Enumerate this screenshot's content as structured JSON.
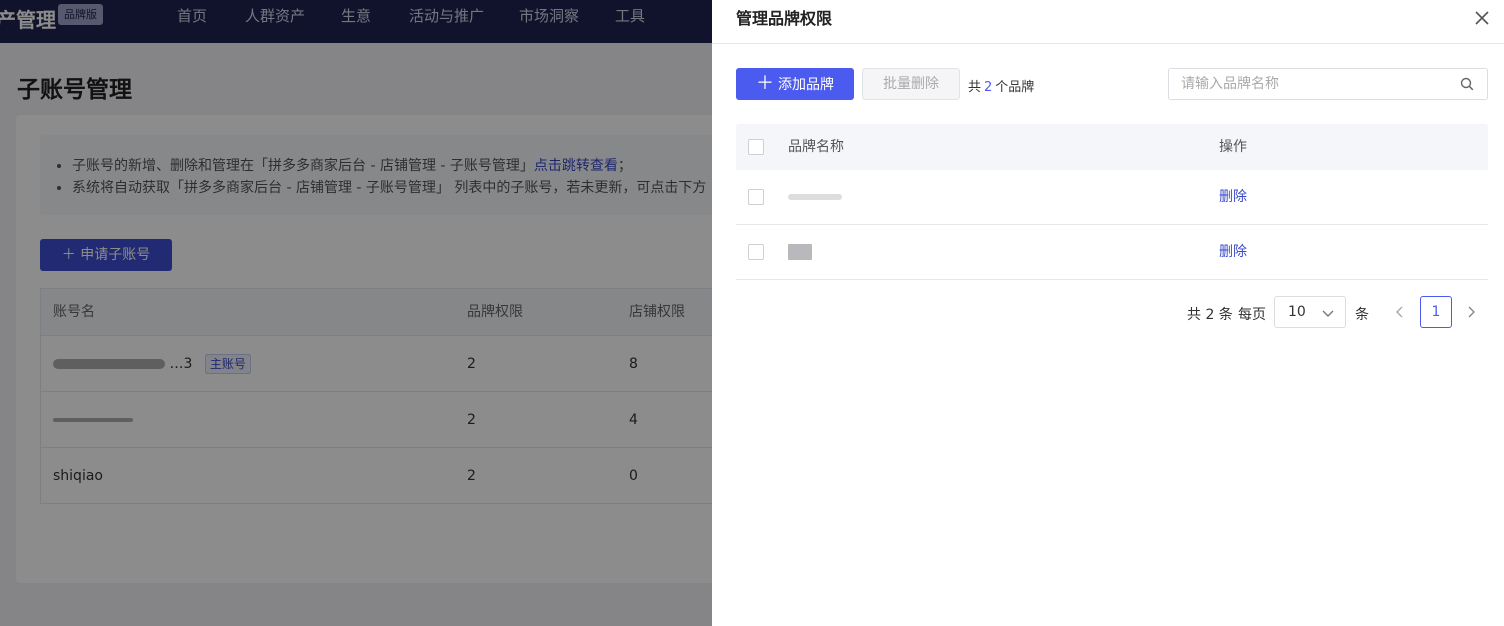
{
  "background": {
    "brand": "产管理",
    "edition_badge": "品牌版",
    "nav": [
      "首页",
      "人群资产",
      "生意",
      "活动与推广",
      "市场洞察",
      "工具"
    ],
    "page_title": "子账号管理",
    "notice": {
      "line1_prefix": "子账号的新增、删除和管理在「拼多多商家后台 - 店铺管理 - 子账号管理」",
      "line1_link": "点击跳转查看",
      "line1_suffix": "；",
      "line2": "系统将自动获取「拼多多商家后台 - 店铺管理 - 子账号管理」 列表中的子账号，若未更新，可点击下方"
    },
    "apply_button": "申请子账号",
    "table": {
      "headers": [
        "账号名",
        "品牌权限",
        "店铺权限"
      ],
      "rows": [
        {
          "account": "…3",
          "tag": "主账号",
          "brand_perm": "2",
          "shop_perm": "8"
        },
        {
          "account": "",
          "tag": "",
          "brand_perm": "2",
          "shop_perm": "4"
        },
        {
          "account": "shiqiao",
          "tag": "",
          "brand_perm": "2",
          "shop_perm": "0"
        }
      ]
    }
  },
  "drawer": {
    "title": "管理品牌权限",
    "add_button": "添加品牌",
    "batch_delete_button": "批量删除",
    "count_prefix": "共",
    "count_value": "2",
    "count_suffix": "个品牌",
    "search_placeholder": "请输入品牌名称",
    "table": {
      "headers": {
        "name": "品牌名称",
        "action": "操作"
      },
      "rows": [
        {
          "name": "",
          "action": "删除"
        },
        {
          "name": "",
          "action": "删除"
        }
      ]
    },
    "pagination": {
      "total": "共 2 条",
      "per_page_label": "每页",
      "page_size": "10",
      "unit": "条",
      "current_page": "1"
    }
  },
  "colors": {
    "primary": "#4b5bf0",
    "nav_bg": "#1f2350",
    "link": "#3a49c8"
  }
}
